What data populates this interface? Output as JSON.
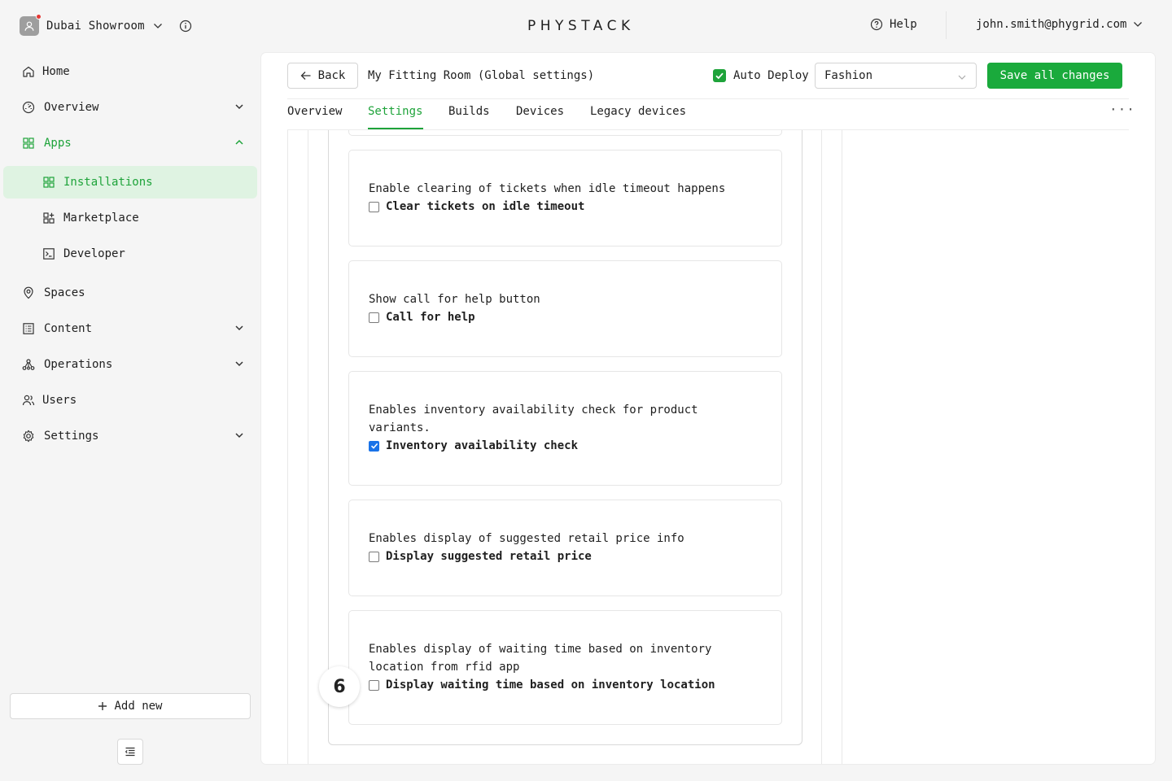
{
  "workspace": {
    "name": "Dubai Showroom"
  },
  "brand": {
    "logo": "PHYSTACK"
  },
  "header": {
    "help_label": "Help",
    "user_email": "john.smith@phygrid.com"
  },
  "sidebar": {
    "items": [
      {
        "label": "Home",
        "icon": "home-icon"
      },
      {
        "label": "Overview",
        "icon": "gauge-icon"
      },
      {
        "label": "Apps",
        "icon": "grid-icon"
      },
      {
        "label": "Installations",
        "icon": "grid-icon"
      },
      {
        "label": "Marketplace",
        "icon": "grid-plus-icon"
      },
      {
        "label": "Developer",
        "icon": "terminal-icon"
      },
      {
        "label": "Spaces",
        "icon": "map-pin-icon"
      },
      {
        "label": "Content",
        "icon": "list-box-icon"
      },
      {
        "label": "Operations",
        "icon": "network-icon"
      },
      {
        "label": "Users",
        "icon": "users-icon"
      },
      {
        "label": "Settings",
        "icon": "gear-icon"
      }
    ],
    "add_new_label": "Add new"
  },
  "page": {
    "back_label": "Back",
    "title": "My Fitting Room (Global settings)",
    "auto_deploy_label": "Auto Deploy",
    "auto_deploy_checked": true,
    "select_value": "Fashion",
    "save_label": "Save all changes"
  },
  "tabs": [
    {
      "label": "Overview"
    },
    {
      "label": "Settings",
      "active": true
    },
    {
      "label": "Builds"
    },
    {
      "label": "Devices"
    },
    {
      "label": "Legacy devices"
    }
  ],
  "more_label": "···",
  "settings": [
    {
      "description": "Enable clearing of tickets when idle timeout happens",
      "option": "Clear tickets on idle timeout",
      "checked": false
    },
    {
      "description": "Show call for help button",
      "option": "Call for help",
      "checked": false
    },
    {
      "description": "Enables inventory availability check for product variants.",
      "option": "Inventory availability check",
      "checked": true
    },
    {
      "description": "Enables display of suggested retail price info",
      "option": "Display suggested retail price",
      "checked": false
    },
    {
      "description": "Enables display of waiting time based on inventory location from rfid app",
      "option": "Display waiting time based on inventory location",
      "checked": false
    }
  ],
  "step_badge": "6",
  "colors": {
    "accent": "#1ea33a",
    "active_bg": "#dff3e2",
    "checkbox_blue": "#1a73e8"
  }
}
